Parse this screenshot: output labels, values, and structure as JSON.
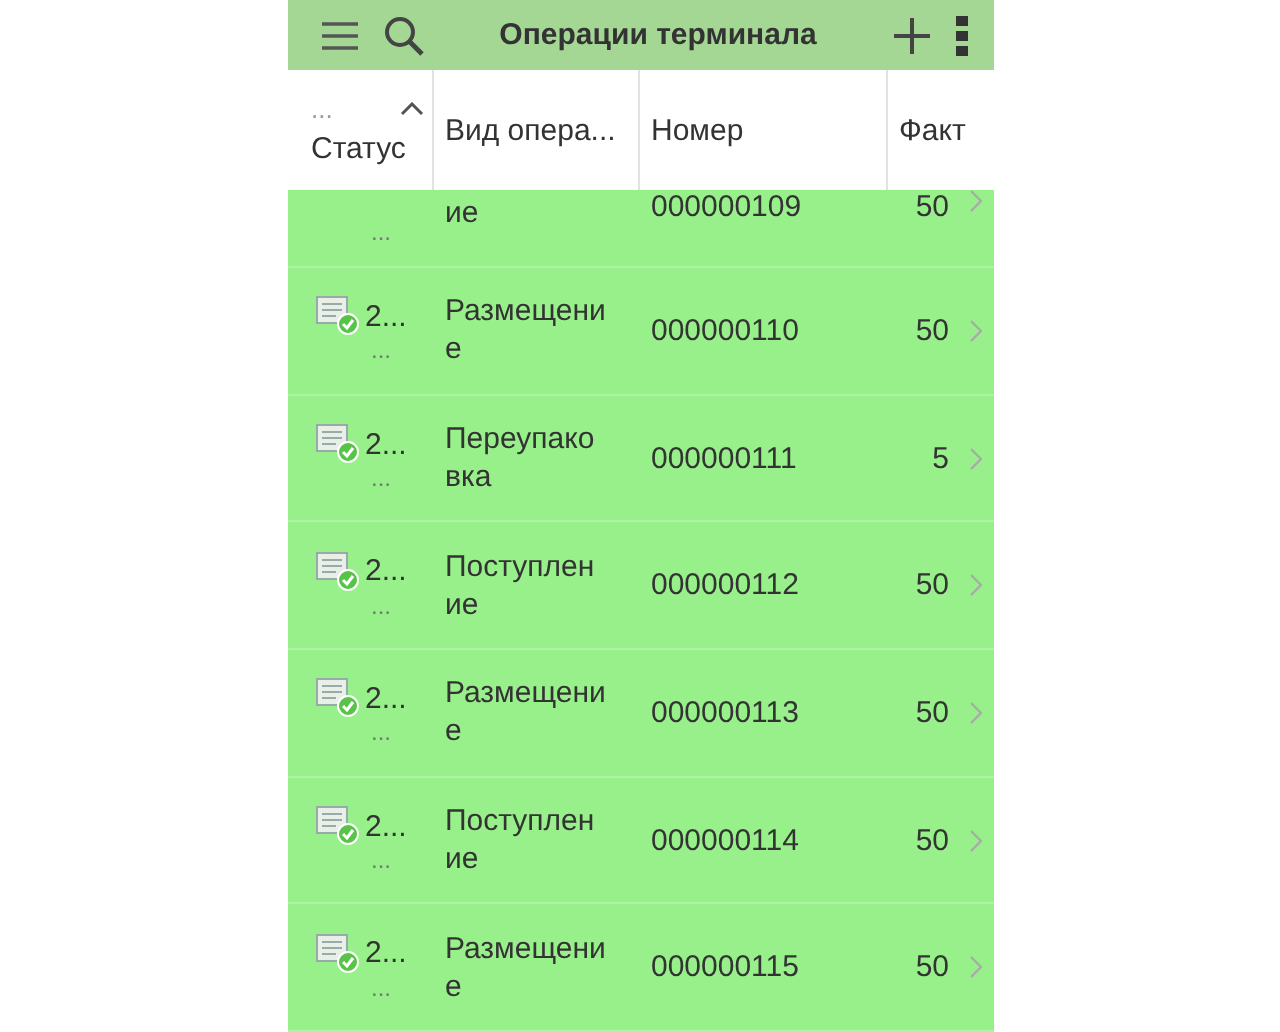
{
  "header": {
    "title": "Операции терминала"
  },
  "columns": [
    {
      "label": "Статус",
      "sort_mark": "...",
      "sorted": true
    },
    {
      "label": "Вид опера...",
      "sorted": false
    },
    {
      "label": "Номер",
      "sorted": false
    },
    {
      "label": "Факт",
      "sorted": false
    }
  ],
  "rows": [
    {
      "kind": "partial",
      "status": [
        "..."
      ],
      "operation": "ие",
      "number": "000000109",
      "fact": "50"
    },
    {
      "kind": "full",
      "status": [
        "2...",
        "..."
      ],
      "operation": "Размещение",
      "number": "000000110",
      "fact": "50"
    },
    {
      "kind": "full",
      "status": [
        "2...",
        "..."
      ],
      "operation": "Переупаковка",
      "number": "000000111",
      "fact": "5"
    },
    {
      "kind": "full",
      "status": [
        "2...",
        "..."
      ],
      "operation": "Поступление",
      "number": "000000112",
      "fact": "50"
    },
    {
      "kind": "full",
      "status": [
        "2...",
        "..."
      ],
      "operation": "Размещение",
      "number": "000000113",
      "fact": "50"
    },
    {
      "kind": "full",
      "status": [
        "2...",
        "..."
      ],
      "operation": "Поступление",
      "number": "000000114",
      "fact": "50"
    },
    {
      "kind": "full",
      "status": [
        "2...",
        "..."
      ],
      "operation": "Размещение",
      "number": "000000115",
      "fact": "50"
    }
  ]
}
